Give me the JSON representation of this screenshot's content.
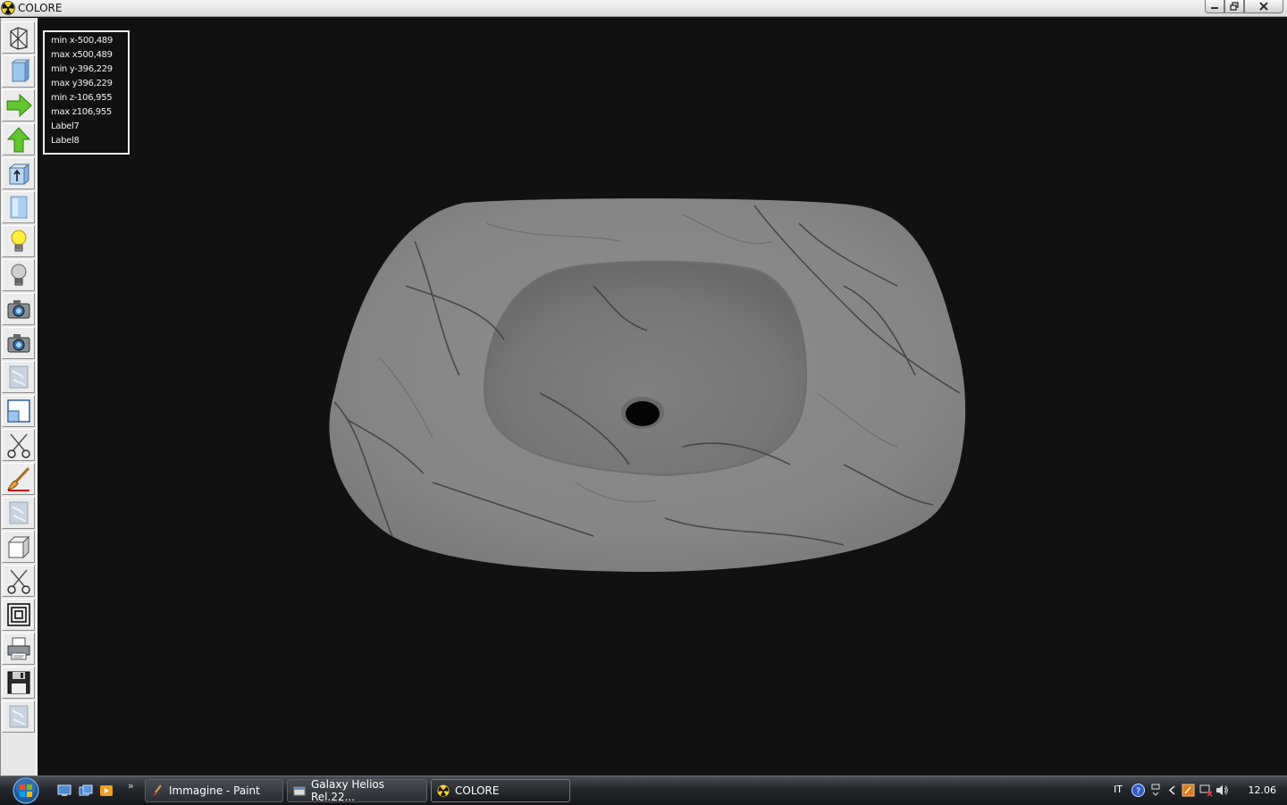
{
  "window": {
    "title": "COLORE",
    "controls": [
      "minimize",
      "maximize",
      "close"
    ]
  },
  "toolbar": {
    "tools": [
      {
        "name": "wireframe-tool",
        "icon": "wireframe-icon"
      },
      {
        "name": "solid-view-tool",
        "icon": "solid-box-icon"
      },
      {
        "name": "arrow-right-tool",
        "icon": "arrow-right-icon"
      },
      {
        "name": "arrow-up-tool",
        "icon": "arrow-up-icon"
      },
      {
        "name": "extrude-tool",
        "icon": "box-arrow-icon"
      },
      {
        "name": "light-blue-panel-tool",
        "icon": "panel-icon"
      },
      {
        "name": "light-on-tool",
        "icon": "lightbulb-on-icon"
      },
      {
        "name": "light-off-tool",
        "icon": "lightbulb-off-icon"
      },
      {
        "name": "camera-1-tool",
        "icon": "camera-icon"
      },
      {
        "name": "camera-2-tool",
        "icon": "camera-icon"
      },
      {
        "name": "texture-1-tool",
        "icon": "marble-texture-icon"
      },
      {
        "name": "window-split-tool",
        "icon": "split-window-icon"
      },
      {
        "name": "cut-1-tool",
        "icon": "scissors-icon"
      },
      {
        "name": "paint-tool",
        "icon": "paintbrush-icon"
      },
      {
        "name": "texture-2-tool",
        "icon": "marble-texture-icon"
      },
      {
        "name": "cube-tool",
        "icon": "cube-icon"
      },
      {
        "name": "cut-2-tool",
        "icon": "scissors-icon"
      },
      {
        "name": "nested-frames-tool",
        "icon": "nested-squares-icon"
      },
      {
        "name": "print-tool",
        "icon": "printer-icon"
      },
      {
        "name": "save-tool",
        "icon": "floppy-disk-icon"
      },
      {
        "name": "texture-3-tool",
        "icon": "marble-texture-icon"
      }
    ]
  },
  "info": {
    "lines": [
      "min x-500,489",
      "max x500,489",
      "min y-396,229",
      "max y396,229",
      "min z-106,955",
      "max z106,955",
      "Label7",
      "Label8"
    ]
  },
  "viewport": {
    "object": "marble-sink-3d-model",
    "colors": {
      "background": "#111111",
      "marble": "#8c8c8c",
      "veins": "#3a3a3a"
    }
  },
  "taskbar": {
    "tasks": [
      {
        "label": "Immagine - Paint",
        "icon": "paint-icon"
      },
      {
        "label": "Galaxy Helios  Rel.22...",
        "icon": "folder-window-icon"
      },
      {
        "label": "COLORE",
        "icon": "radiation-icon"
      }
    ],
    "tray": {
      "language": "IT",
      "clock": "12.06"
    }
  },
  "colors": {
    "titlebar": "#e6e6e6",
    "toolbar": "#e8e8e8",
    "taskbar": "#1e2226"
  }
}
